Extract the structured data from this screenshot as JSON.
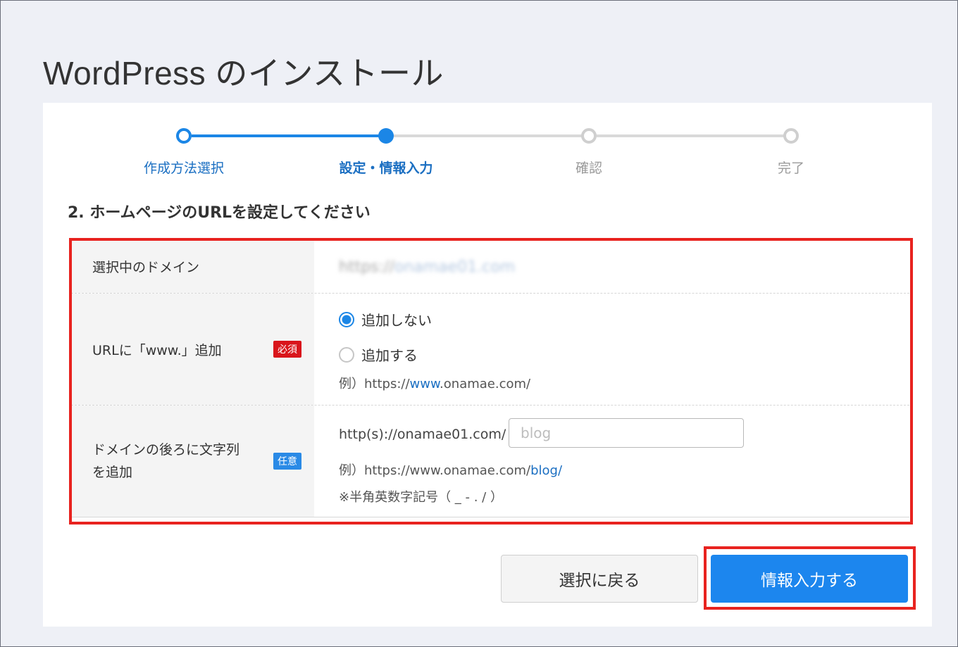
{
  "page": {
    "title": "WordPress のインストール"
  },
  "stepper": {
    "steps": [
      {
        "label": "作成方法選択",
        "state": "done"
      },
      {
        "label": "設定・情報入力",
        "state": "current"
      },
      {
        "label": "確認",
        "state": "todo"
      },
      {
        "label": "完了",
        "state": "todo"
      }
    ]
  },
  "section": {
    "heading": "2. ホームページのURLを設定してください"
  },
  "form": {
    "domain_row": {
      "label": "選択中のドメイン",
      "value_scheme": "https://",
      "value_domain": "onamae01.com"
    },
    "www_row": {
      "label": "URLに「www.」追加",
      "badge": "必須",
      "option_no": "追加しない",
      "option_yes": "追加する",
      "selected": "追加しない",
      "example_prefix": "例）https://",
      "example_highlight": "www",
      "example_suffix": ".onamae.com/"
    },
    "path_row": {
      "label_line1": "ドメインの後ろに文字列",
      "label_line2": "を追加",
      "badge": "任意",
      "url_prefix": "http(s)://onamae01.com/",
      "input_value": "",
      "input_placeholder": "blog",
      "example_prefix": "例）https://www.onamae.com/",
      "example_highlight": "blog/",
      "note": "※半角英数字記号（ _ - . / ）"
    }
  },
  "buttons": {
    "back_label": "選択に戻る",
    "submit_label": "情報入力する"
  },
  "colors": {
    "accent": "#1c86ee",
    "highlight": "#e8231f",
    "required_badge": "#d9151b",
    "optional_badge": "#2a8ae6"
  }
}
